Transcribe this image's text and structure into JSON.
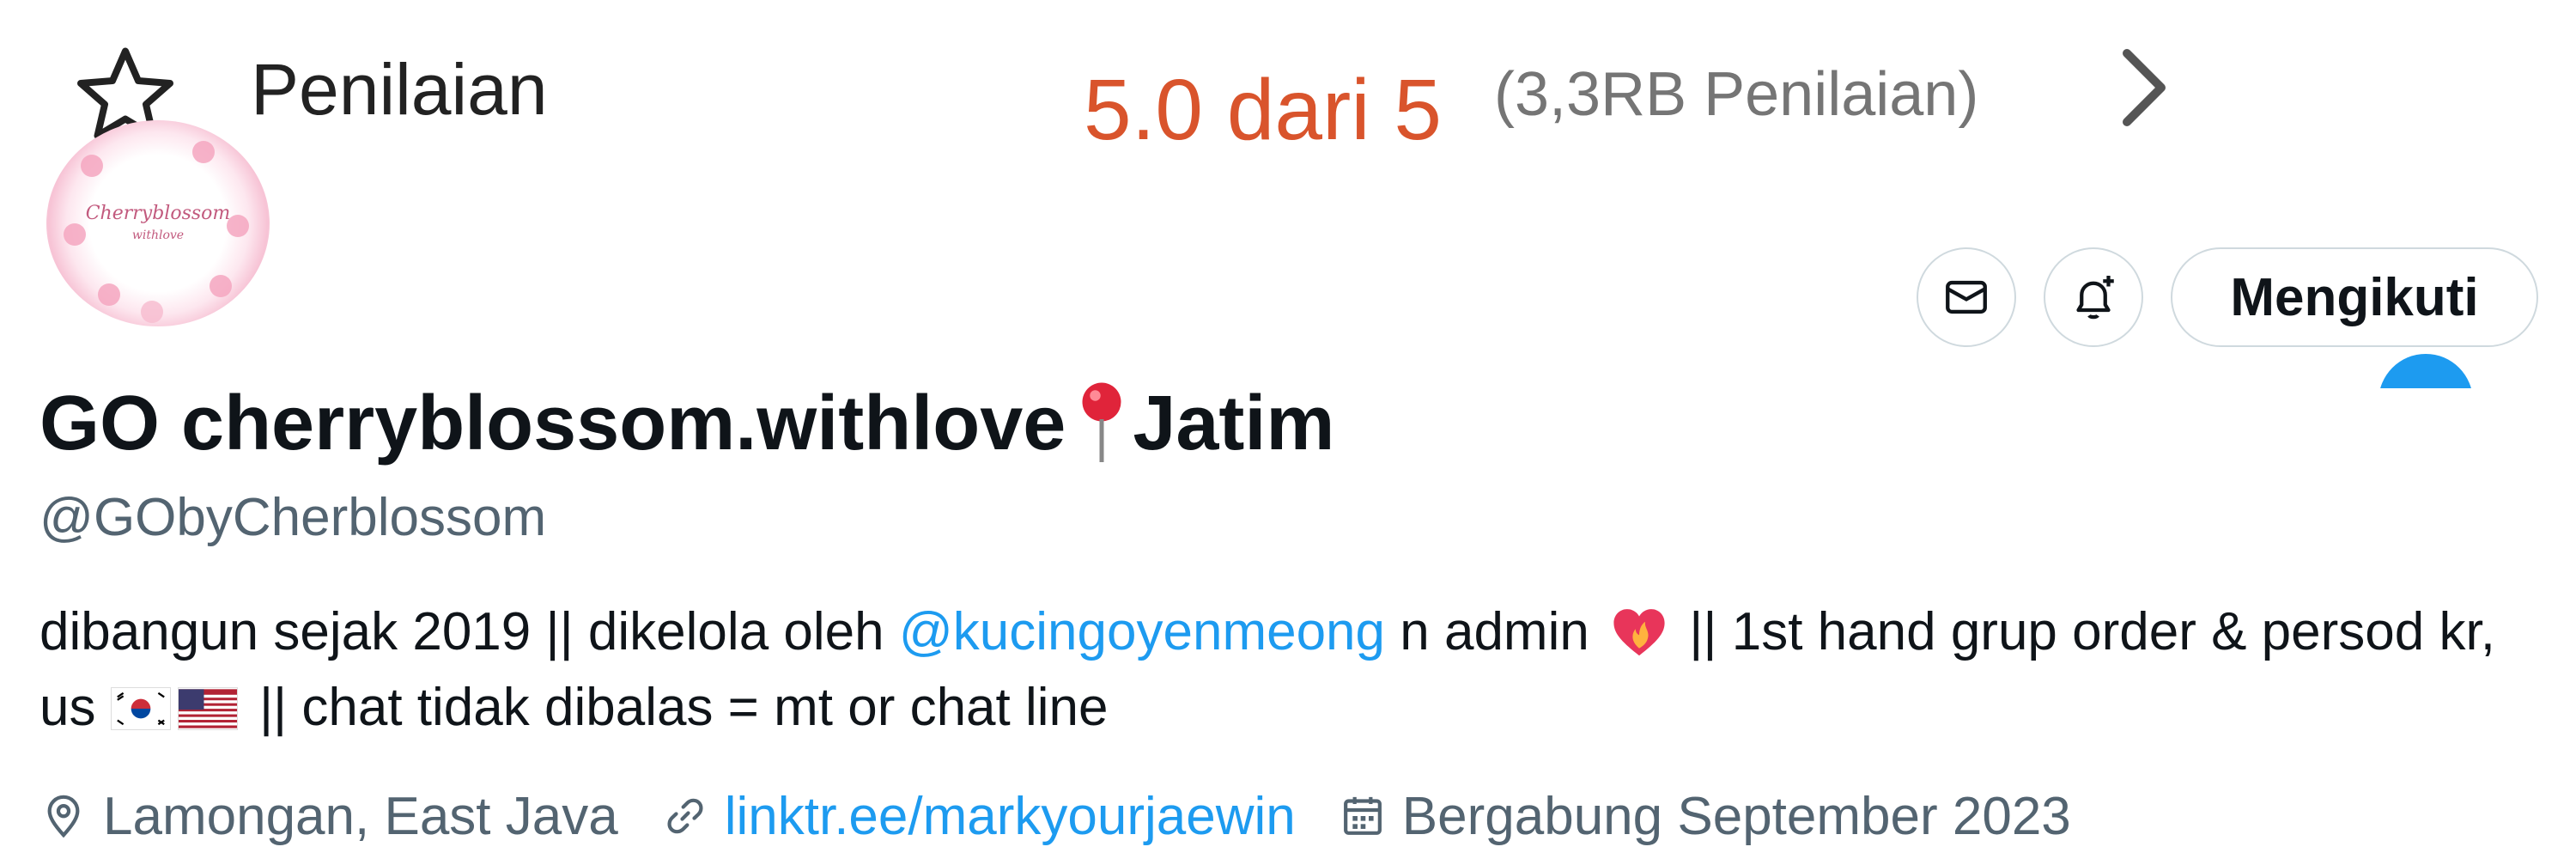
{
  "rating": {
    "label": "Penilaian",
    "score": "5.0 dari 5",
    "count": "(3,3RB Penilaian)"
  },
  "avatar": {
    "text": "Cherryblossom",
    "subtext": "withlove"
  },
  "actions": {
    "follow_label": "Mengikuti"
  },
  "profile": {
    "display_name": "GO cherryblossom.withlove",
    "display_name_suffix": "Jatim",
    "handle": "@GObyCherblossom",
    "bio": {
      "part1": "dibangun sejak 2019 || dikelola oleh ",
      "mention": "@kucingoyenmeong",
      "part2": " n admin",
      "part3": " || 1st hand grup order & persod kr, us ",
      "part4": " || chat tidak dibalas = mt or chat line"
    },
    "location": "Lamongan, East Java",
    "website": "linktr.ee/markyourjaewin",
    "joined": "Bergabung September 2023"
  },
  "icons": [
    "star-icon",
    "chevron-right-icon",
    "mail-icon",
    "bell-plus-icon",
    "pin-icon",
    "heart-fire-icon",
    "flag-korea-icon",
    "flag-us-icon",
    "location-icon",
    "link-icon",
    "calendar-icon"
  ],
  "colors": {
    "accent": "#1d9bf0",
    "rating": "#d9542c",
    "muted": "#536471",
    "text": "#0f1419"
  }
}
